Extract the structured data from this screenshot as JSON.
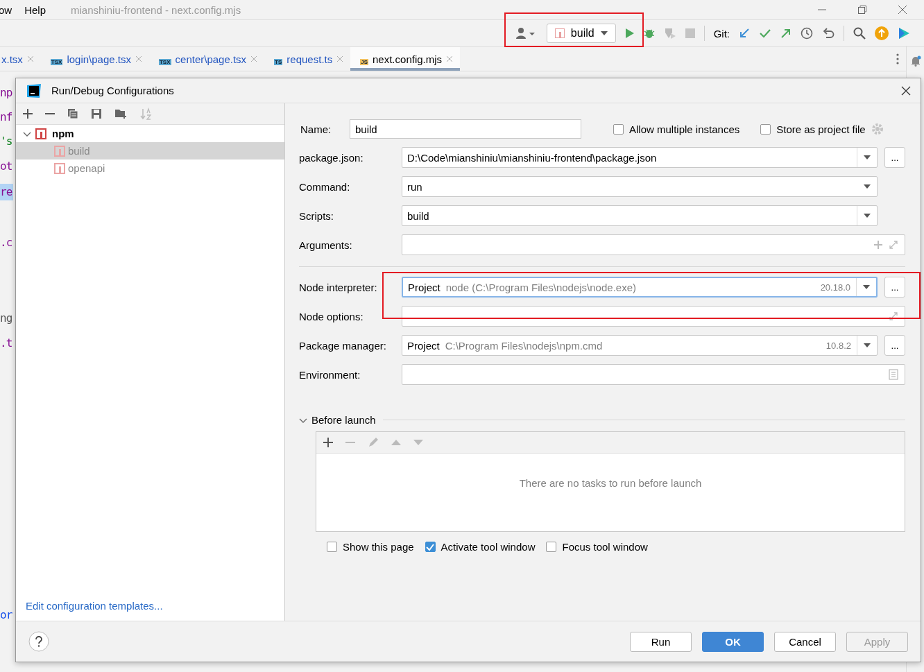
{
  "menubar": {
    "items": [
      "ow",
      "Help"
    ],
    "title": "mianshiniu-frontend - next.config.mjs"
  },
  "toolbar": {
    "run_config": "build",
    "git_label": "Git:"
  },
  "editor_tabs": [
    {
      "label": "x.tsx",
      "selected": false
    },
    {
      "label": "login\\page.tsx",
      "badge": "TSX",
      "selected": false
    },
    {
      "label": "center\\page.tsx",
      "badge": "TSX",
      "selected": false
    },
    {
      "label": "request.ts",
      "badge": "TS",
      "selected": false
    },
    {
      "label": "next.config.mjs",
      "badge": "JS",
      "selected": true
    }
  ],
  "code_fragments": [
    {
      "text": "np",
      "color": "#871094"
    },
    {
      "text": "nf",
      "color": "#871094"
    },
    {
      "text": "'s",
      "color": "#067d17"
    },
    {
      "text": "ot",
      "color": "#871094"
    },
    {
      "text": "re",
      "color": "#871094",
      "highlighted": true
    },
    {
      "text": ".c",
      "color": "#871094"
    },
    {
      "text": "ng",
      "color": "#555555"
    },
    {
      "text": ".t",
      "color": "#871094"
    },
    {
      "text": "or",
      "color": "#1750eb"
    }
  ],
  "dialog": {
    "title": "Run/Debug Configurations",
    "tree": [
      {
        "label": "npm",
        "expanded": true,
        "children": [
          {
            "label": "build",
            "selected": true
          },
          {
            "label": "openapi",
            "selected": false
          }
        ]
      }
    ],
    "templates_link": "Edit configuration templates...",
    "name": {
      "label": "Name:",
      "value": "build"
    },
    "options": [
      {
        "label": "Allow multiple instances",
        "checked": false
      },
      {
        "label": "Store as project file",
        "checked": false
      }
    ],
    "fields": [
      {
        "kind": "combo",
        "label": "package.json:",
        "value": "D:\\Code\\mianshiniu\\mianshiniu-frontend\\package.json",
        "browse": "..."
      },
      {
        "kind": "combo",
        "label": "Command:",
        "value": "run"
      },
      {
        "kind": "combo",
        "label": "Scripts:",
        "value": "build",
        "arrow_box": true
      },
      {
        "kind": "text",
        "label": "Arguments:",
        "add": true
      }
    ],
    "fields2": [
      {
        "kind": "interpreter",
        "label": "Node interpreter:",
        "prefix": "Project",
        "value": "node (C:\\Program Files\\nodejs\\node.exe)",
        "version": "20.18.0",
        "browse": "...",
        "focused": true
      },
      {
        "kind": "text",
        "label": "Node options:"
      },
      {
        "kind": "interpreter",
        "label": "Package manager:",
        "prefix": "Project",
        "value": "C:\\Program Files\\nodejs\\npm.cmd",
        "version": "10.8.2",
        "browse": "...",
        "focused": false
      },
      {
        "kind": "env",
        "label": "Environment:"
      }
    ],
    "before_launch": {
      "title": "Before launch",
      "expanded": true,
      "empty_text": "There are no tasks to run before launch"
    },
    "launch_options": [
      {
        "label": "Show this page",
        "checked": false
      },
      {
        "label": "Activate tool window",
        "checked": true
      },
      {
        "label": "Focus tool window",
        "checked": false
      }
    ],
    "buttons": [
      {
        "label": "Run",
        "kind": "normal"
      },
      {
        "label": "OK",
        "kind": "primary"
      },
      {
        "label": "Cancel",
        "kind": "normal"
      },
      {
        "label": "Apply",
        "kind": "disabled"
      }
    ]
  }
}
